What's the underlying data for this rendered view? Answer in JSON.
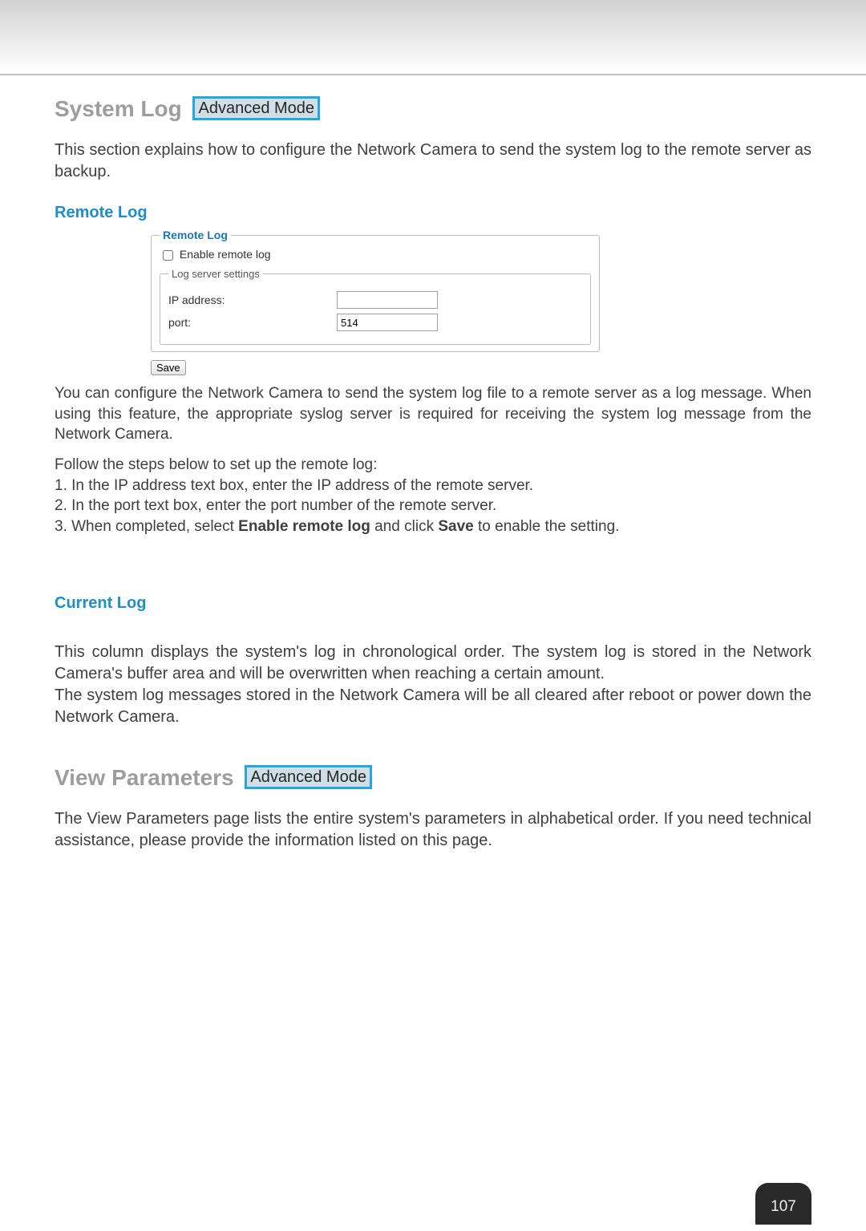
{
  "section1": {
    "title": "System Log",
    "badge": "Advanced Mode",
    "intro": "This section explains how to configure the Network Camera to send the system log to the remote server as backup."
  },
  "remote_log": {
    "heading": "Remote Log",
    "fieldset_title": "Remote Log",
    "enable_label": "Enable remote log",
    "settings_title": "Log server settings",
    "ip_label": "IP address:",
    "ip_value": "",
    "port_label": "port:",
    "port_value": "514",
    "save_label": "Save",
    "desc": "You can configure the Network Camera to send the system log file to a remote server as a log message. When using this feature, the appropriate syslog server is required for receiving the system log message from the Network Camera.",
    "steps_intro": "Follow the steps below to set up the remote log:",
    "step1": "1. In the IP address text box, enter the IP address of the remote server.",
    "step2": "2. In the port text box, enter the port number of the remote server.",
    "step3_pre": "3. When completed, select ",
    "step3_bold1": "Enable remote log",
    "step3_mid": " and click ",
    "step3_bold2": "Save",
    "step3_post": " to enable the setting."
  },
  "current_log": {
    "heading": "Current Log",
    "p1": "This column displays the system's log in chronological order. The system log is stored in the Network Camera's buffer area and will be overwritten when reaching a certain amount.",
    "p2": "The system log messages stored in the Network Camera will be all cleared after reboot or power down the Network Camera."
  },
  "section2": {
    "title": "View Parameters",
    "badge": "Advanced Mode",
    "intro": "The View Parameters page lists the entire system's parameters in alphabetical order. If you need technical assistance, please provide the information listed on this page."
  },
  "page_number": "107"
}
